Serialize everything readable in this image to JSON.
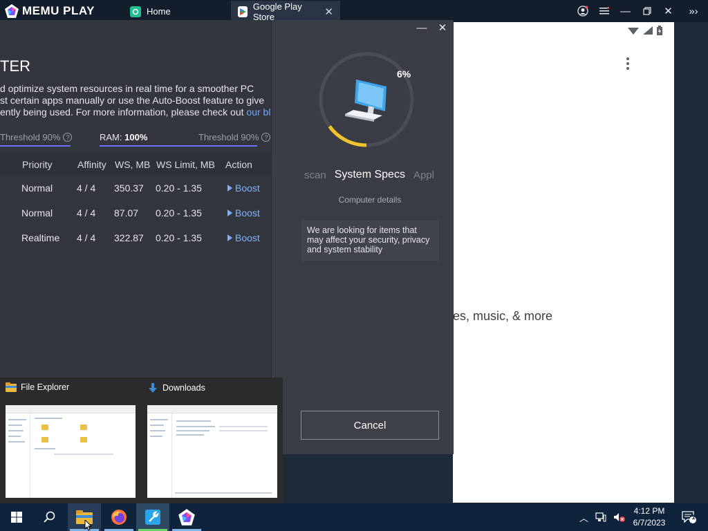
{
  "memu": {
    "logo_text": "MEMU PLAY",
    "tabs": [
      {
        "label": "Home",
        "icon": "home-app-icon"
      },
      {
        "label": "Google Play Store",
        "icon": "play-store-icon"
      }
    ]
  },
  "android": {
    "body_text": "es, music, & more"
  },
  "booster": {
    "title": "TER",
    "desc_line1": "d optimize system resources in real time for a smoother PC",
    "desc_line2": "st certain apps manually or use the Auto-Boost feature to give",
    "desc_line3": "ently being used. For more information, please check out ",
    "desc_link": "our blog",
    "desc_end": ".",
    "cpu_threshold": "Threshold 90%",
    "ram_label": "RAM: ",
    "ram_value": "100%",
    "ram_threshold": "Threshold 90%",
    "ram_level_percent": 100,
    "threshold_percent": 90,
    "columns": [
      "Priority",
      "Affinity",
      "WS, MB",
      "WS Limit, MB",
      "Action"
    ],
    "rows": [
      {
        "priority": "Normal",
        "affinity": "4 / 4",
        "ws": "350.37",
        "ws_limit": "0.20 - 1.35",
        "action": "Boost"
      },
      {
        "priority": "Normal",
        "affinity": "4 / 4",
        "ws": "87.07",
        "ws_limit": "0.20 - 1.35",
        "action": "Boost"
      },
      {
        "priority": "Realtime",
        "affinity": "4 / 4",
        "ws": "322.87",
        "ws_limit": "0.20 - 1.35",
        "action": "Boost"
      }
    ],
    "scan_percent_label": "6%",
    "scan_progress": 6,
    "tab_prev": "scan",
    "tab_active": "System Specs",
    "tab_next": "Appl",
    "subtitle": "Computer details",
    "info_text": "We are looking for items that may affect your security, privacy and system stability",
    "cancel_label": "Cancel",
    "colors": {
      "accent_blue": "#6b72ff",
      "ring_yellow": "#f2c32c",
      "link": "#6fa8ff"
    }
  },
  "thumbnails": [
    {
      "title": "File Explorer",
      "icon": "file-explorer-icon"
    },
    {
      "title": "Downloads",
      "icon": "downloads-icon"
    }
  ],
  "taskbar": {
    "time": "4:12 PM",
    "date": "6/7/2023",
    "notification_count": "1"
  }
}
